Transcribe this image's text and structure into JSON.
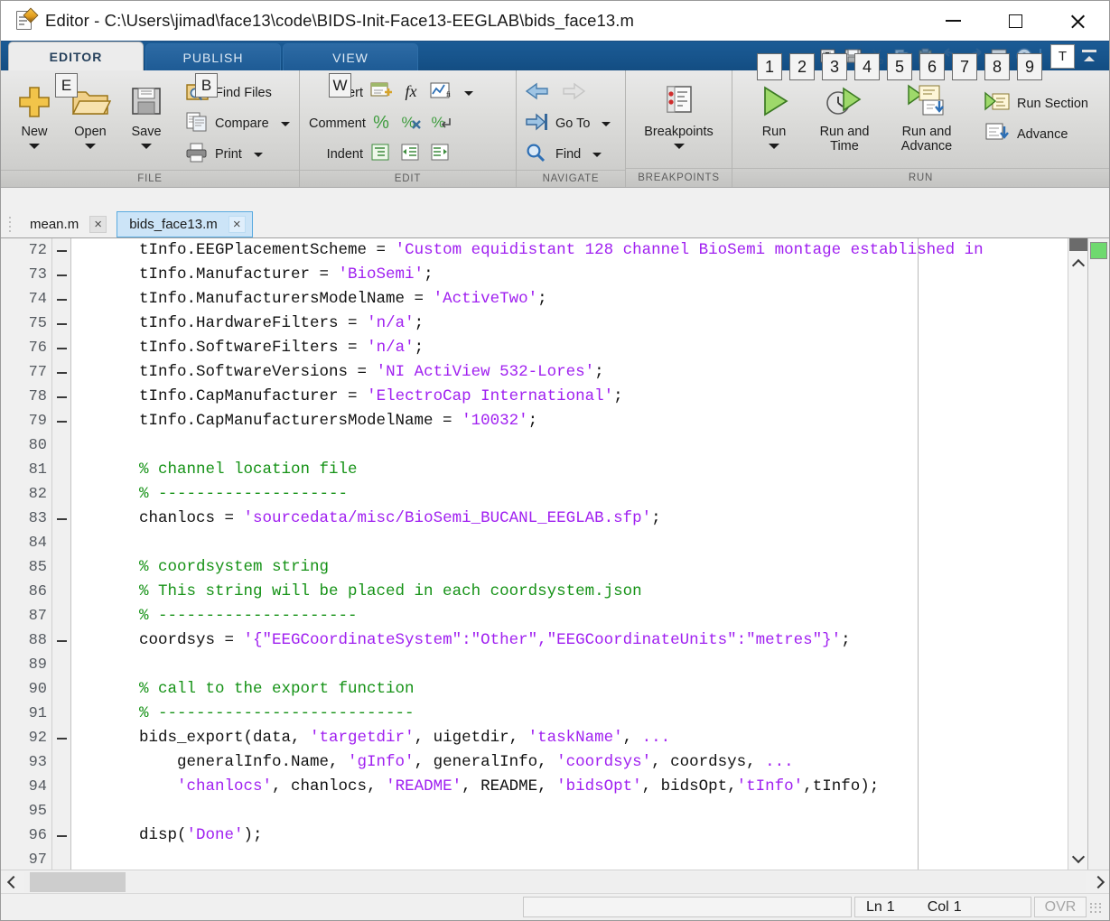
{
  "window": {
    "title": "Editor - C:\\Users\\jimad\\face13\\code\\BIDS-Init-Face13-EEGLAB\\bids_face13.m",
    "icon": "editor-document-pencil-icon",
    "minimize": "—",
    "maximize": "□",
    "close": "✕"
  },
  "ribbon": {
    "tabs": [
      {
        "label": "EDITOR",
        "active": true
      },
      {
        "label": "PUBLISH",
        "active": false
      },
      {
        "label": "VIEW",
        "active": false
      }
    ],
    "quick_access": {
      "items": [
        {
          "name": "new-script-icon",
          "keytip": "1"
        },
        {
          "name": "save-icon",
          "keytip": "2"
        },
        {
          "name": "cut-icon",
          "keytip": "3"
        },
        {
          "name": "copy-icon",
          "keytip": "4"
        },
        {
          "name": "paste-icon",
          "keytip": "5"
        },
        {
          "name": "undo-icon",
          "keytip": "6"
        },
        {
          "name": "redo-icon",
          "keytip": "7"
        },
        {
          "name": "switch-windows-icon",
          "keytip": "8"
        },
        {
          "name": "help-icon",
          "keytip": "9"
        }
      ],
      "text_button": "T",
      "collapse": "collapse-ribbon-icon"
    },
    "groups": [
      {
        "label": "FILE",
        "big_buttons": [
          {
            "label": "New",
            "icon": "new-plus-icon",
            "keytip": null,
            "dropdown": true
          },
          {
            "label": "Open",
            "icon": "open-folder-icon",
            "keytip": "E",
            "dropdown": true
          },
          {
            "label": "Save",
            "icon": "save-floppy-icon",
            "keytip": null,
            "dropdown": true
          }
        ],
        "small_buttons": [
          {
            "label": "Find Files",
            "icon": "find-files-icon",
            "keytip": "B",
            "dropdown": false
          },
          {
            "label": "Compare",
            "icon": "compare-icon",
            "keytip": null,
            "dropdown": true
          },
          {
            "label": "Print",
            "icon": "print-icon",
            "keytip": null,
            "dropdown": true
          }
        ]
      },
      {
        "label": "EDIT",
        "rows": [
          {
            "label": "Insert",
            "keytip": "W",
            "icons": [
              "insert-block-icon",
              "insert-function-icon",
              "insert-figure-icon"
            ],
            "dropdown": true
          },
          {
            "label": "Comment",
            "keytip": null,
            "icons": [
              "comment-percent-icon",
              "uncomment-icon",
              "wrap-comment-icon"
            ],
            "dropdown": false
          },
          {
            "label": "Indent",
            "keytip": null,
            "icons": [
              "smart-indent-icon",
              "indent-right-icon",
              "indent-left-icon"
            ],
            "dropdown": false
          }
        ]
      },
      {
        "label": "NAVIGATE",
        "rows": [
          {
            "label": "",
            "icons": [
              "back-arrow-icon",
              "forward-arrow-icon"
            ]
          },
          {
            "label": "Go To",
            "icons": [
              "go-to-icon"
            ],
            "dropdown": true
          },
          {
            "label": "Find",
            "icons": [
              "find-magnifier-icon"
            ],
            "dropdown": true
          }
        ]
      },
      {
        "label": "BREAKPOINTS",
        "big_buttons": [
          {
            "label": "Breakpoints",
            "icon": "breakpoints-icon",
            "dropdown": true
          }
        ]
      },
      {
        "label": "RUN",
        "big_buttons": [
          {
            "label": "Run",
            "icon": "run-play-icon",
            "dropdown": true
          },
          {
            "label": "Run and\nTime",
            "icon": "run-and-time-icon",
            "dropdown": false
          },
          {
            "label": "Run and\nAdvance",
            "icon": "run-and-advance-icon",
            "dropdown": false
          }
        ],
        "small_buttons": [
          {
            "label": "Run Section",
            "icon": "run-section-icon"
          },
          {
            "label": "Advance",
            "icon": "advance-icon"
          }
        ]
      }
    ]
  },
  "file_tabs": [
    {
      "label": "mean.m",
      "active": false,
      "close": "×"
    },
    {
      "label": "bids_face13.m",
      "active": true,
      "close": "×"
    }
  ],
  "editor": {
    "first_line": 72,
    "lines": [
      {
        "n": "72",
        "bp": true,
        "segments": [
          {
            "t": "    tInfo.EEGPlacementScheme = ",
            "c": "plain"
          },
          {
            "t": "'Custom equidistant 128 channel BioSemi montage established in",
            "c": "str"
          }
        ]
      },
      {
        "n": "73",
        "bp": true,
        "segments": [
          {
            "t": "    tInfo.Manufacturer = ",
            "c": "plain"
          },
          {
            "t": "'BioSemi'",
            "c": "str"
          },
          {
            "t": ";",
            "c": "plain"
          }
        ]
      },
      {
        "n": "74",
        "bp": true,
        "segments": [
          {
            "t": "    tInfo.ManufacturersModelName = ",
            "c": "plain"
          },
          {
            "t": "'ActiveTwo'",
            "c": "str"
          },
          {
            "t": ";",
            "c": "plain"
          }
        ]
      },
      {
        "n": "75",
        "bp": true,
        "segments": [
          {
            "t": "    tInfo.HardwareFilters = ",
            "c": "plain"
          },
          {
            "t": "'n/a'",
            "c": "str"
          },
          {
            "t": ";",
            "c": "plain"
          }
        ]
      },
      {
        "n": "76",
        "bp": true,
        "segments": [
          {
            "t": "    tInfo.SoftwareFilters = ",
            "c": "plain"
          },
          {
            "t": "'n/a'",
            "c": "str"
          },
          {
            "t": ";",
            "c": "plain"
          }
        ]
      },
      {
        "n": "77",
        "bp": true,
        "segments": [
          {
            "t": "    tInfo.SoftwareVersions = ",
            "c": "plain"
          },
          {
            "t": "'NI ActiView 532-Lores'",
            "c": "str"
          },
          {
            "t": ";",
            "c": "plain"
          }
        ]
      },
      {
        "n": "78",
        "bp": true,
        "segments": [
          {
            "t": "    tInfo.CapManufacturer = ",
            "c": "plain"
          },
          {
            "t": "'ElectroCap International'",
            "c": "str"
          },
          {
            "t": ";",
            "c": "plain"
          }
        ]
      },
      {
        "n": "79",
        "bp": true,
        "segments": [
          {
            "t": "    tInfo.CapManufacturersModelName = ",
            "c": "plain"
          },
          {
            "t": "'10032'",
            "c": "str"
          },
          {
            "t": ";",
            "c": "plain"
          }
        ]
      },
      {
        "n": "80",
        "bp": false,
        "segments": []
      },
      {
        "n": "81",
        "bp": false,
        "segments": [
          {
            "t": "    % channel location file",
            "c": "com"
          }
        ]
      },
      {
        "n": "82",
        "bp": false,
        "segments": [
          {
            "t": "    % --------------------",
            "c": "com"
          }
        ]
      },
      {
        "n": "83",
        "bp": true,
        "segments": [
          {
            "t": "    chanlocs = ",
            "c": "plain"
          },
          {
            "t": "'sourcedata/misc/BioSemi_BUCANL_EEGLAB.sfp'",
            "c": "str"
          },
          {
            "t": ";",
            "c": "plain"
          }
        ]
      },
      {
        "n": "84",
        "bp": false,
        "segments": []
      },
      {
        "n": "85",
        "bp": false,
        "segments": [
          {
            "t": "    % coordsystem string",
            "c": "com"
          }
        ]
      },
      {
        "n": "86",
        "bp": false,
        "segments": [
          {
            "t": "    % This string will be placed in each coordsystem.json",
            "c": "com"
          }
        ]
      },
      {
        "n": "87",
        "bp": false,
        "segments": [
          {
            "t": "    % ---------------------",
            "c": "com"
          }
        ]
      },
      {
        "n": "88",
        "bp": true,
        "segments": [
          {
            "t": "    coordsys = ",
            "c": "plain"
          },
          {
            "t": "'{\"EEGCoordinateSystem\":\"Other\",\"EEGCoordinateUnits\":\"metres\"}'",
            "c": "str"
          },
          {
            "t": ";",
            "c": "plain"
          }
        ]
      },
      {
        "n": "89",
        "bp": false,
        "segments": []
      },
      {
        "n": "90",
        "bp": false,
        "segments": [
          {
            "t": "    % call to the export function",
            "c": "com"
          }
        ]
      },
      {
        "n": "91",
        "bp": false,
        "segments": [
          {
            "t": "    % ---------------------------",
            "c": "com"
          }
        ]
      },
      {
        "n": "92",
        "bp": true,
        "segments": [
          {
            "t": "    bids_export(data, ",
            "c": "plain"
          },
          {
            "t": "'targetdir'",
            "c": "str"
          },
          {
            "t": ", uigetdir, ",
            "c": "plain"
          },
          {
            "t": "'taskName'",
            "c": "str"
          },
          {
            "t": ", ",
            "c": "plain"
          },
          {
            "t": "...",
            "c": "str"
          }
        ]
      },
      {
        "n": "93",
        "bp": false,
        "segments": [
          {
            "t": "        generalInfo.Name, ",
            "c": "plain"
          },
          {
            "t": "'gInfo'",
            "c": "str"
          },
          {
            "t": ", generalInfo, ",
            "c": "plain"
          },
          {
            "t": "'coordsys'",
            "c": "str"
          },
          {
            "t": ", coordsys, ",
            "c": "plain"
          },
          {
            "t": "...",
            "c": "str"
          }
        ]
      },
      {
        "n": "94",
        "bp": false,
        "segments": [
          {
            "t": "        ",
            "c": "plain"
          },
          {
            "t": "'chanlocs'",
            "c": "str"
          },
          {
            "t": ", chanlocs, ",
            "c": "plain"
          },
          {
            "t": "'README'",
            "c": "str"
          },
          {
            "t": ", README, ",
            "c": "plain"
          },
          {
            "t": "'bidsOpt'",
            "c": "str"
          },
          {
            "t": ", bidsOpt,",
            "c": "plain"
          },
          {
            "t": "'tInfo'",
            "c": "str"
          },
          {
            "t": ",tInfo);",
            "c": "plain"
          }
        ]
      },
      {
        "n": "95",
        "bp": false,
        "segments": []
      },
      {
        "n": "96",
        "bp": true,
        "segments": [
          {
            "t": "    disp(",
            "c": "plain"
          },
          {
            "t": "'Done'",
            "c": "str"
          },
          {
            "t": ");",
            "c": "plain"
          }
        ]
      },
      {
        "n": "97",
        "bp": false,
        "segments": []
      }
    ],
    "analyzer_status": "ok",
    "colors": {
      "string": "#a020f0",
      "comment": "#159216",
      "plain": "#111111",
      "analyzer_ok": "#6fd96f"
    }
  },
  "statusbar": {
    "message": "",
    "line_label": "Ln",
    "line_value": "1",
    "col_label": "Col",
    "col_value": "1",
    "overwrite": "OVR"
  }
}
